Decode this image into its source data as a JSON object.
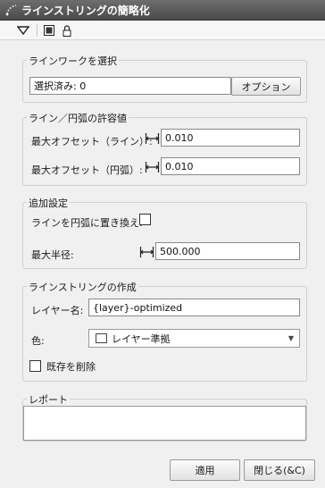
{
  "window": {
    "title": "ラインストリングの簡略化"
  },
  "toolbar": {
    "icons": [
      "menu-triangle-icon",
      "screen-icon",
      "lock-icon"
    ]
  },
  "linework": {
    "title": "ラインワークを選択",
    "selection_value": "選択済み: 0",
    "options_button": "オプション"
  },
  "tolerance": {
    "title": "ライン／円弧の許容値",
    "line_label": "最大オフセット（ライン）:",
    "line_value": "0.010",
    "arc_label": "最大オフセット（円弧）:",
    "arc_value": "0.010"
  },
  "additional": {
    "title": "追加設定",
    "replace_label": "ラインを円弧に置き換え:",
    "replace_checked": false,
    "radius_label": "最大半径:",
    "radius_value": "500.000"
  },
  "create": {
    "title": "ラインストリングの作成",
    "layer_label": "レイヤー名:",
    "layer_value": "{layer}-optimized",
    "color_label": "色:",
    "color_value": "レイヤー準拠",
    "delete_label": "既存を削除",
    "delete_checked": false
  },
  "report": {
    "title": "レポート",
    "content": ""
  },
  "footer": {
    "apply": "適用",
    "close": "閉じる(&C)"
  }
}
